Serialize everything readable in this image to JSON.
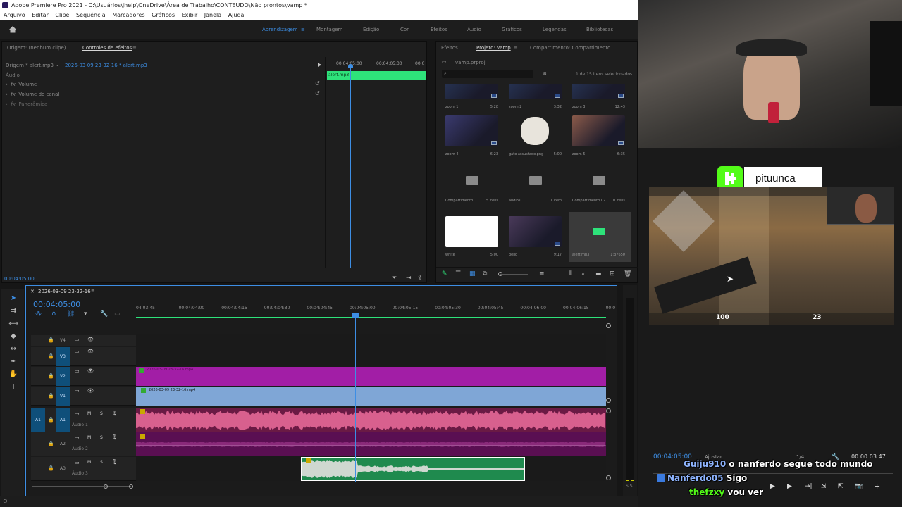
{
  "window": {
    "title": "Adobe Premiere Pro 2021 - C:\\Usuários\\jheip\\OneDrive\\Área de Trabalho\\CONTEUDO\\Não prontos\\vamp *"
  },
  "menu": [
    "Arquivo",
    "Editar",
    "Clipe",
    "Sequência",
    "Marcadores",
    "Gráficos",
    "Exibir",
    "Janela",
    "Ajuda"
  ],
  "workspaces": {
    "active": "Aprendizagem",
    "items": [
      "Montagem",
      "Edição",
      "Cor",
      "Efeitos",
      "Áudio",
      "Gráficos",
      "Legendas",
      "Bibliotecas"
    ]
  },
  "effect_controls": {
    "source_tab": "Origem: (nenhum clipe)",
    "tab": "Controles de efeitos",
    "clip_master": "Origem * alert.mp3",
    "clip_seq": "2026-03-09 23-32-16 * alert.mp3",
    "section": "Áudio",
    "rows": [
      "Volume",
      "Volume do canal",
      "Panorâmica"
    ],
    "fx": "fx",
    "ruler_labels": [
      "00:04:05:00",
      "00:04:05:30",
      "00:0"
    ],
    "mini_clip": "alert.mp3",
    "timecode": "00:04:05:00"
  },
  "project": {
    "tabs": [
      "Efeitos",
      "Projeto: vamp",
      "Compartimento: Compartimento"
    ],
    "file": "vamp.prproj",
    "selected_info": "1 de 15 itens selecionados",
    "items": [
      {
        "name": "zoom 1",
        "dur": "5:28",
        "kind": "video",
        "color": "#2a3a5e"
      },
      {
        "name": "zoom 2",
        "dur": "3:32",
        "kind": "video",
        "color": "#2a3a5e"
      },
      {
        "name": "zoom 3",
        "dur": "12:43",
        "kind": "video",
        "color": "#2a3a5e"
      },
      {
        "name": "zoom 4",
        "dur": "6:23",
        "kind": "video",
        "color": "#3a3a6e"
      },
      {
        "name": "gato assustado.png",
        "dur": "5:00",
        "kind": "image",
        "color": "#e8e4dc"
      },
      {
        "name": "zoom 5",
        "dur": "6:35",
        "kind": "video",
        "color": "#8a5a4a"
      },
      {
        "name": "Compartimento",
        "dur": "5 itens",
        "kind": "folder",
        "color": "#1e1e1e"
      },
      {
        "name": "audios",
        "dur": "1 item",
        "kind": "folder",
        "color": "#1e1e1e"
      },
      {
        "name": "Compartimento 02",
        "dur": "0 itens",
        "kind": "folder",
        "color": "#1e1e1e"
      },
      {
        "name": "white",
        "dur": "5:00",
        "kind": "image",
        "color": "#ffffff"
      },
      {
        "name": "beijo",
        "dur": "9:17",
        "kind": "video",
        "color": "#4a3a5a"
      },
      {
        "name": "alert.mp3",
        "dur": "1:37650",
        "kind": "audio",
        "color": "#3a3a3a"
      }
    ]
  },
  "timeline": {
    "seq_name": "2026-03-09 23-32-16",
    "timecode": "00:04:05:00",
    "ruler": [
      "04:03:45",
      "00:04:04:00",
      "00:04:04:15",
      "00:04:04:30",
      "00:04:04:45",
      "00:04:05:00",
      "00:04:05:15",
      "00:04:05:30",
      "00:04:05:45",
      "00:04:06:00",
      "00:04:06:15",
      "00:0"
    ],
    "video_tracks": [
      "V4",
      "V3",
      "V2",
      "V1"
    ],
    "audio_tracks": [
      {
        "id": "A1",
        "label": "Áudio 1"
      },
      {
        "id": "A2",
        "label": "Áudio 2"
      },
      {
        "id": "A3",
        "label": "Áudio 3"
      }
    ],
    "clips": {
      "v2": "2026-03-09 23-32-16.mp4",
      "v1": "2026-03-09 23-32-16.mp4"
    },
    "track_buttons": {
      "m": "M",
      "s": "S"
    }
  },
  "program": {
    "timecode": "00:04:05:00",
    "fit": "Ajustar",
    "resolution": "1/4",
    "duration": "00:00:03:47"
  },
  "stream": {
    "channel": "pituunca",
    "hud_health": "100",
    "hud_ammo": "23"
  },
  "chat": [
    {
      "user": "Guiju910",
      "msg": "o nanferdo segue todo mundo"
    },
    {
      "user": "Nanferdo05",
      "msg": "Sigo"
    },
    {
      "user": "thefzxy",
      "msg": "vou ver"
    }
  ],
  "colors": {
    "accent": "#3d8ee4",
    "v2_clip": "#a21ea6",
    "v1_clip": "#7fa6d6",
    "a1_clip": "#c2406e",
    "a2_clip": "#7a1a6a",
    "a3_clip": "#1f8a4e",
    "kick_green": "#53fc18"
  }
}
